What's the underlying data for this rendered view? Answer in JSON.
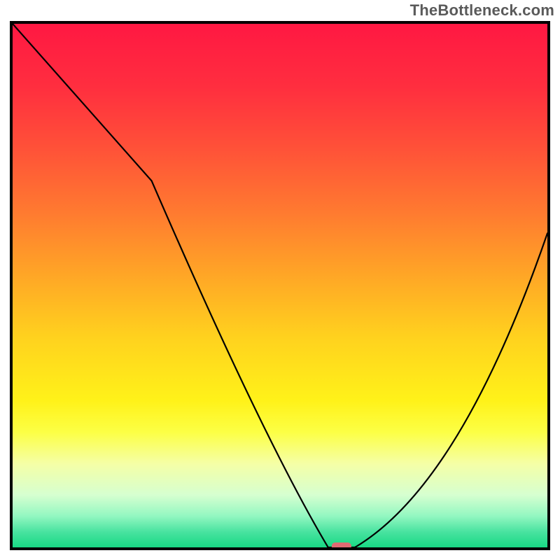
{
  "watermark": "TheBottleneck.com",
  "chart_data": {
    "type": "line",
    "title": "",
    "xlabel": "",
    "ylabel": "",
    "xlim": [
      0,
      100
    ],
    "ylim": [
      0,
      100
    ],
    "grid": false,
    "legend": false,
    "x": [
      0,
      26,
      59,
      64,
      100
    ],
    "values": [
      100,
      70,
      0,
      0,
      60
    ],
    "curve": [
      {
        "x": 0,
        "y": 100
      },
      {
        "x": 26,
        "y": 70
      },
      {
        "x": 59,
        "y": 0
      },
      {
        "x": 64,
        "y": 0
      },
      {
        "x": 100,
        "y": 60
      }
    ],
    "marker": {
      "x": 61.5,
      "y": 0,
      "color": "#e06b72"
    },
    "gradient_stops": [
      {
        "offset": 0.0,
        "color": "#ff1842"
      },
      {
        "offset": 0.12,
        "color": "#ff2e3f"
      },
      {
        "offset": 0.24,
        "color": "#ff5238"
      },
      {
        "offset": 0.36,
        "color": "#ff7a30"
      },
      {
        "offset": 0.48,
        "color": "#ffa626"
      },
      {
        "offset": 0.6,
        "color": "#ffd21e"
      },
      {
        "offset": 0.72,
        "color": "#fff219"
      },
      {
        "offset": 0.78,
        "color": "#fcff45"
      },
      {
        "offset": 0.84,
        "color": "#f5ffa6"
      },
      {
        "offset": 0.9,
        "color": "#d6ffd0"
      },
      {
        "offset": 0.94,
        "color": "#93f7c1"
      },
      {
        "offset": 0.97,
        "color": "#49e3a0"
      },
      {
        "offset": 1.0,
        "color": "#18d884"
      }
    ]
  }
}
